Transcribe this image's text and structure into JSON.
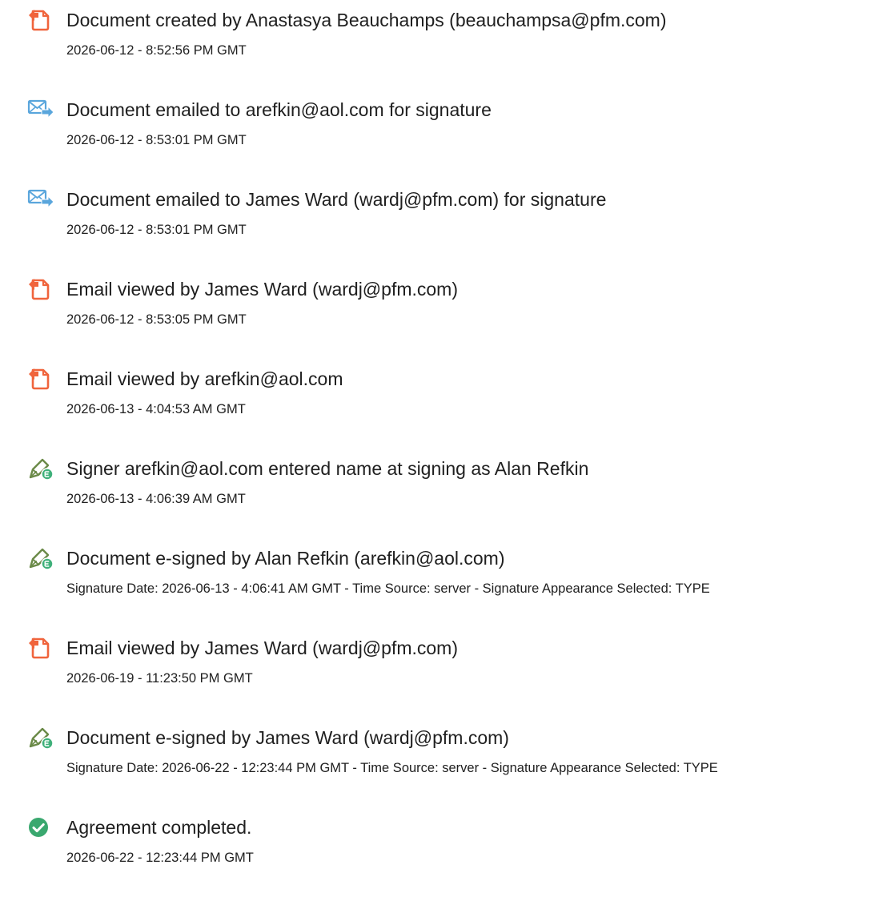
{
  "events": [
    {
      "icon": "document-created-icon",
      "title": "Document created by Anastasya Beauchamps (beauchampsa@pfm.com)",
      "detail": "2026-06-12 - 8:52:56 PM GMT"
    },
    {
      "icon": "email-sent-icon",
      "title": "Document emailed to arefkin@aol.com for signature",
      "detail": "2026-06-12 - 8:53:01 PM GMT"
    },
    {
      "icon": "email-sent-icon",
      "title": "Document emailed to James Ward (wardj@pfm.com) for signature",
      "detail": "2026-06-12 - 8:53:01 PM GMT"
    },
    {
      "icon": "document-viewed-icon",
      "title": "Email viewed by James Ward (wardj@pfm.com)",
      "detail": "2026-06-12 - 8:53:05 PM GMT"
    },
    {
      "icon": "document-viewed-icon",
      "title": "Email viewed by arefkin@aol.com",
      "detail": "2026-06-13 - 4:04:53 AM GMT"
    },
    {
      "icon": "e-sign-pen-icon",
      "title": "Signer arefkin@aol.com entered name at signing as Alan Refkin",
      "detail": "2026-06-13 - 4:06:39 AM GMT"
    },
    {
      "icon": "e-sign-pen-icon",
      "title": "Document e-signed by Alan Refkin (arefkin@aol.com)",
      "detail": "Signature Date: 2026-06-13 - 4:06:41 AM GMT - Time Source: server - Signature Appearance Selected: TYPE"
    },
    {
      "icon": "document-viewed-icon",
      "title": "Email viewed by James Ward (wardj@pfm.com)",
      "detail": "2026-06-19 - 11:23:50 PM GMT"
    },
    {
      "icon": "e-sign-pen-icon",
      "title": "Document e-signed by James Ward (wardj@pfm.com)",
      "detail": "Signature Date: 2026-06-22 - 12:23:44 PM GMT - Time Source: server - Signature Appearance Selected: TYPE"
    },
    {
      "icon": "completed-check-icon",
      "title": "Agreement completed.",
      "detail": "2026-06-22 - 12:23:44 PM GMT"
    }
  ],
  "colors": {
    "document_icon": "#f0643c",
    "email_icon": "#5aa6dc",
    "sign_pen_icon": "#6b8a48",
    "sign_badge": "#3fb07a",
    "check_icon": "#3aa86f",
    "text": "#202020"
  }
}
